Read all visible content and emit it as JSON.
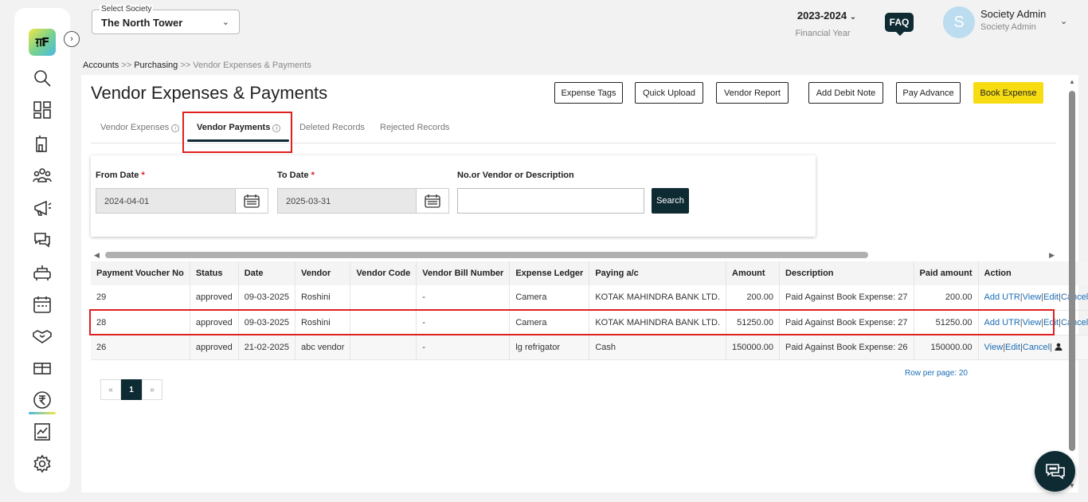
{
  "header": {
    "society_label": "Select Society",
    "society_value": "The North Tower",
    "fy_year": "2023-2024",
    "fy_label": "Financial Year",
    "faq": "FAQ",
    "avatar_letter": "S",
    "user_name": "Society Admin",
    "user_role": "Society Admin"
  },
  "breadcrumb": {
    "accounts": "Accounts",
    "sep1": " >> ",
    "purchasing": "Purchasing",
    "sep2": " >> ",
    "current": "Vendor Expenses & Payments"
  },
  "page": {
    "title": "Vendor Expenses & Payments"
  },
  "actions": {
    "expense_tags": "Expense Tags",
    "quick_upload": "Quick Upload",
    "vendor_report": "Vendor Report",
    "add_debit_note": "Add Debit Note",
    "pay_advance": "Pay Advance",
    "book_expense": "Book Expense"
  },
  "tabs": {
    "vendor_expenses": "Vendor Expenses",
    "vendor_payments": "Vendor Payments",
    "deleted_records": "Deleted Records",
    "rejected_records": "Rejected Records"
  },
  "filters": {
    "from_date_label": "From Date",
    "from_date_value": "2024-04-01",
    "to_date_label": "To Date",
    "to_date_value": "2025-03-31",
    "required_mark": "*",
    "search_label": "No.or Vendor or Description",
    "search_value": "",
    "search_button": "Search"
  },
  "table": {
    "headers": [
      "Payment Voucher No",
      "Status",
      "Date",
      "Vendor",
      "Vendor Code",
      "Vendor Bill Number",
      "Expense Ledger",
      "Paying a/c",
      "Amount",
      "Description",
      "Paid amount",
      "Action"
    ],
    "rows": [
      {
        "voucher": "29",
        "status": "approved",
        "date": "09-03-2025",
        "vendor": "Roshini",
        "code": "",
        "bill": "-",
        "ledger": "Camera",
        "paying": "KOTAK MAHINDRA BANK LTD.",
        "amount": "200.00",
        "desc": "Paid Against Book Expense: 27",
        "paid": "200.00"
      },
      {
        "voucher": "28",
        "status": "approved",
        "date": "09-03-2025",
        "vendor": "Roshini",
        "code": "",
        "bill": "-",
        "ledger": "Camera",
        "paying": "KOTAK MAHINDRA BANK LTD.",
        "amount": "51250.00",
        "desc": "Paid Against Book Expense: 27",
        "paid": "51250.00"
      },
      {
        "voucher": "26",
        "status": "approved",
        "date": "21-02-2025",
        "vendor": "abc vendor",
        "code": "",
        "bill": "-",
        "ledger": "lg refrigator",
        "paying": "Cash",
        "amount": "150000.00",
        "desc": "Paid Against Book Expense: 26",
        "paid": "150000.00"
      }
    ],
    "action_labels": {
      "add_utr": "Add UTR",
      "view": "View",
      "edit": "Edit",
      "cancel": "Cancel",
      "sep": "|"
    }
  },
  "pagination": {
    "prev": "«",
    "current": "1",
    "next": "»",
    "rows_per_page": "Row per page: 20"
  }
}
